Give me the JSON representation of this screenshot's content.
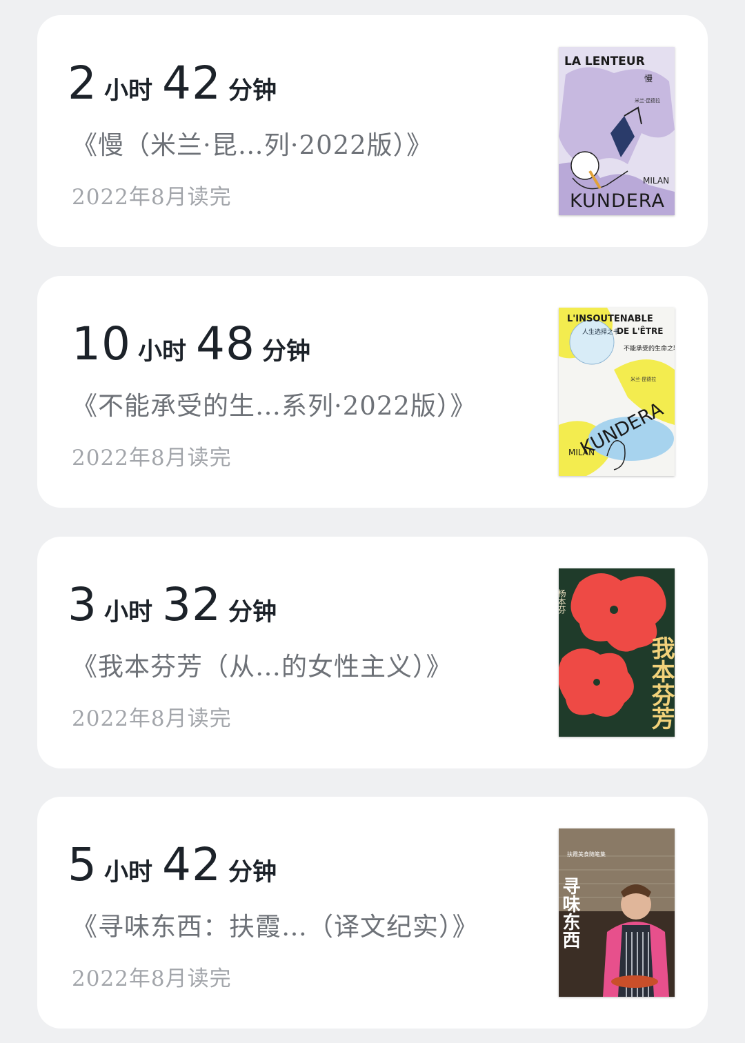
{
  "books": [
    {
      "hours": "2",
      "hour_unit": "小时",
      "minutes": "42",
      "minute_unit": "分钟",
      "title": "《慢（米兰·昆…列·2022版）》",
      "finished": "2022年8月读完",
      "cover": {
        "top_text": "LA LENTEUR",
        "cn_title": "慢",
        "author_cn": "米兰·昆德拉",
        "brand_en": "MILAN",
        "brand_word": "KUNDERA",
        "bg_color": "#c7b9e0"
      }
    },
    {
      "hours": "10",
      "hour_unit": "小时",
      "minutes": "48",
      "minute_unit": "分钟",
      "title": "《不能承受的生…系列·2022版）》",
      "finished": "2022年8月读完",
      "cover": {
        "top_text": "L'INSOUTENABLE",
        "top_text_2": "DE L'ÊTRE",
        "cn_title": "不能承受的生命之轻",
        "badge": "人生选择之书",
        "author_cn": "米兰·昆德拉",
        "brand_en": "MILAN",
        "brand_word": "KUNDERA",
        "bg_color": "#f3ec4f"
      }
    },
    {
      "hours": "3",
      "hour_unit": "小时",
      "minutes": "32",
      "minute_unit": "分钟",
      "title": "《我本芬芳（从…的女性主义）》",
      "finished": "2022年8月读完",
      "cover": {
        "cn_title": "我本芬芳",
        "author_cn": "杨本芬",
        "bg_color": "#1f3b2a"
      }
    },
    {
      "hours": "5",
      "hour_unit": "小时",
      "minutes": "42",
      "minute_unit": "分钟",
      "title": "《寻味东西：扶霞…（译文纪实）》",
      "finished": "2022年8月读完",
      "cover": {
        "cn_title": "寻味东西",
        "series": "扶霞美食随笔集",
        "bg_color": "#6b5a4a"
      }
    }
  ]
}
